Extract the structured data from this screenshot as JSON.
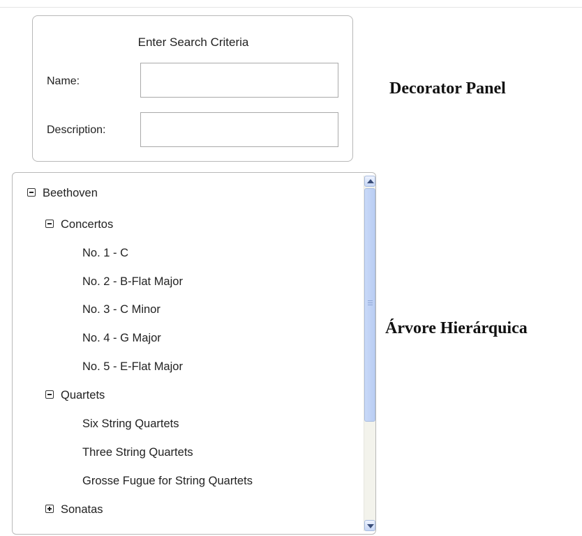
{
  "search": {
    "title": "Enter Search Criteria",
    "name_label": "Name:",
    "name_value": "",
    "description_label": "Description:",
    "description_value": ""
  },
  "labels": {
    "decorator": "Decorator Panel",
    "tree": "Árvore Hierárquica"
  },
  "tree": {
    "root": "Beethoven",
    "concertos": "Concertos",
    "concerto_items": [
      "No. 1 - C",
      "No. 2 - B-Flat Major",
      "No. 3 - C Minor",
      "No. 4 - G Major",
      "No. 5 - E-Flat Major"
    ],
    "quartets": "Quartets",
    "quartet_items": [
      "Six String Quartets",
      "Three String Quartets",
      "Grosse Fugue for String Quartets"
    ],
    "sonatas": "Sonatas"
  }
}
